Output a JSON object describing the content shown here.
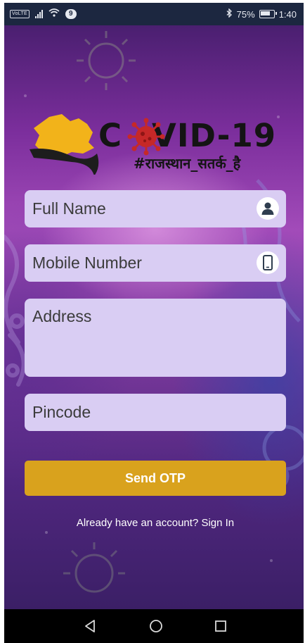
{
  "status_bar": {
    "volte": "VoLTE",
    "notification_count": "9",
    "battery": "75%",
    "time": "1:40"
  },
  "logo": {
    "title_left": "C",
    "title_right": "VID-19",
    "tagline": "#राजस्थान_सतर्क_है",
    "map_color": "#f2b31a"
  },
  "form": {
    "full_name_placeholder": "Full Name",
    "mobile_placeholder": "Mobile Number",
    "address_placeholder": "Address",
    "pincode_placeholder": "Pincode",
    "send_otp_label": "Send OTP"
  },
  "footer": {
    "prompt": "Already have an account?",
    "sign_in": "Sign In"
  },
  "icons": {
    "full_name": "person-icon",
    "mobile": "mobile-phone-icon"
  },
  "colors": {
    "button": "#d9a21d",
    "field": "#d9cdf3",
    "virus": "#c62828"
  }
}
